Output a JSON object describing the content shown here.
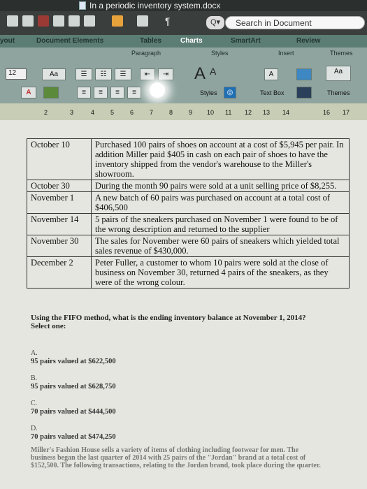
{
  "window": {
    "title": "In a periodic inventory system.docx"
  },
  "search": {
    "placeholder": "Search in Document"
  },
  "tabs": [
    "yout",
    "Document Elements",
    "Tables",
    "Charts",
    "SmartArt",
    "Review"
  ],
  "ribbon": {
    "groups": [
      "Paragraph",
      "Styles",
      "Insert",
      "Themes"
    ],
    "font_size": "12",
    "styles_label": "Styles",
    "textbox_label": "Text Box",
    "themes_label": "Themes",
    "aa_label": "Aa"
  },
  "ruler": {
    "numbers": [
      "2",
      "3",
      "4",
      "5",
      "6",
      "7",
      "8",
      "9",
      "10",
      "11",
      "12",
      "13",
      "14",
      "16",
      "17"
    ]
  },
  "transactions": [
    {
      "date": "October 10",
      "text": "Purchased 100 pairs of shoes on account at a cost of $5,945 per pair. In addition Miller paid $405 in cash on each pair of shoes to have the inventory shipped from the vendor's warehouse to the Miller's showroom."
    },
    {
      "date": "October 30",
      "text": "During the month 90 pairs were sold at a unit selling price of $8,255."
    },
    {
      "date": "November 1",
      "text": "A new batch of 60 pairs was purchased on account at a total cost of $406,500"
    },
    {
      "date": "November 14",
      "text": "5 pairs of the sneakers purchased on November 1 were found to be of the wrong description and returned to the supplier"
    },
    {
      "date": "November 30",
      "text": "The sales for November were 60 pairs of sneakers which yielded total sales revenue of $430,000."
    },
    {
      "date": "December 2",
      "text": "Peter Fuller, a customer to whom 10 pairs were sold at the close of business on November 30, returned 4 pairs of the sneakers, as they were of the wrong colour."
    }
  ],
  "question": {
    "text": "Using the FIFO method, what is the ending inventory balance at November 1, 2014?",
    "select_label": "Select one:"
  },
  "options": [
    {
      "letter": "A.",
      "text": "95 pairs valued at $622,500"
    },
    {
      "letter": "B.",
      "text": "95 pairs valued at $628,750"
    },
    {
      "letter": "C.",
      "text": "70 pairs valued at $444,500"
    },
    {
      "letter": "D.",
      "text": "70 pairs valued at $474,250"
    }
  ],
  "footer": "Miller's Fashion House sells a variety of items of clothing including footwear for men. The business began the last quarter of 2014 with 25 pairs of the \"Jordan\" brand at a total cost of $152,500. The following transactions, relating to the Jordan brand, took place during the quarter."
}
